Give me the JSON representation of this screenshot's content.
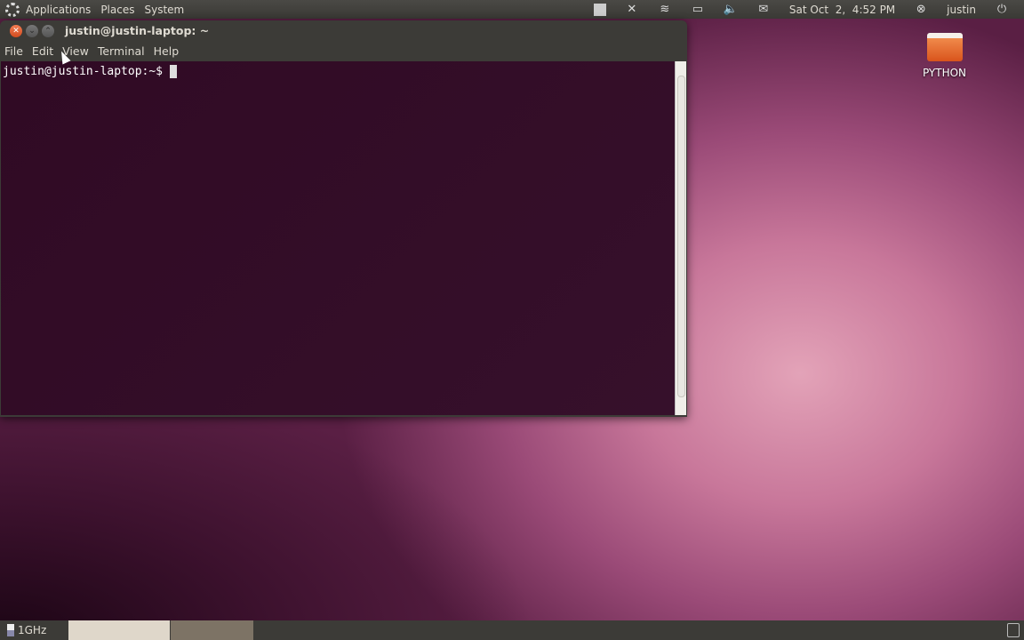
{
  "top_panel": {
    "menus": [
      "Applications",
      "Places",
      "System"
    ],
    "datetime": "Sat Oct  2,  4:52 PM",
    "user": "justin"
  },
  "window": {
    "title": "justin@justin-laptop: ~",
    "menus": [
      "File",
      "Edit",
      "View",
      "Terminal",
      "Help"
    ],
    "prompt": "justin@justin-laptop:~$"
  },
  "desktop": {
    "icon_label": "PYTHON"
  },
  "bottom_panel": {
    "cpu_freq": "1GHz"
  }
}
